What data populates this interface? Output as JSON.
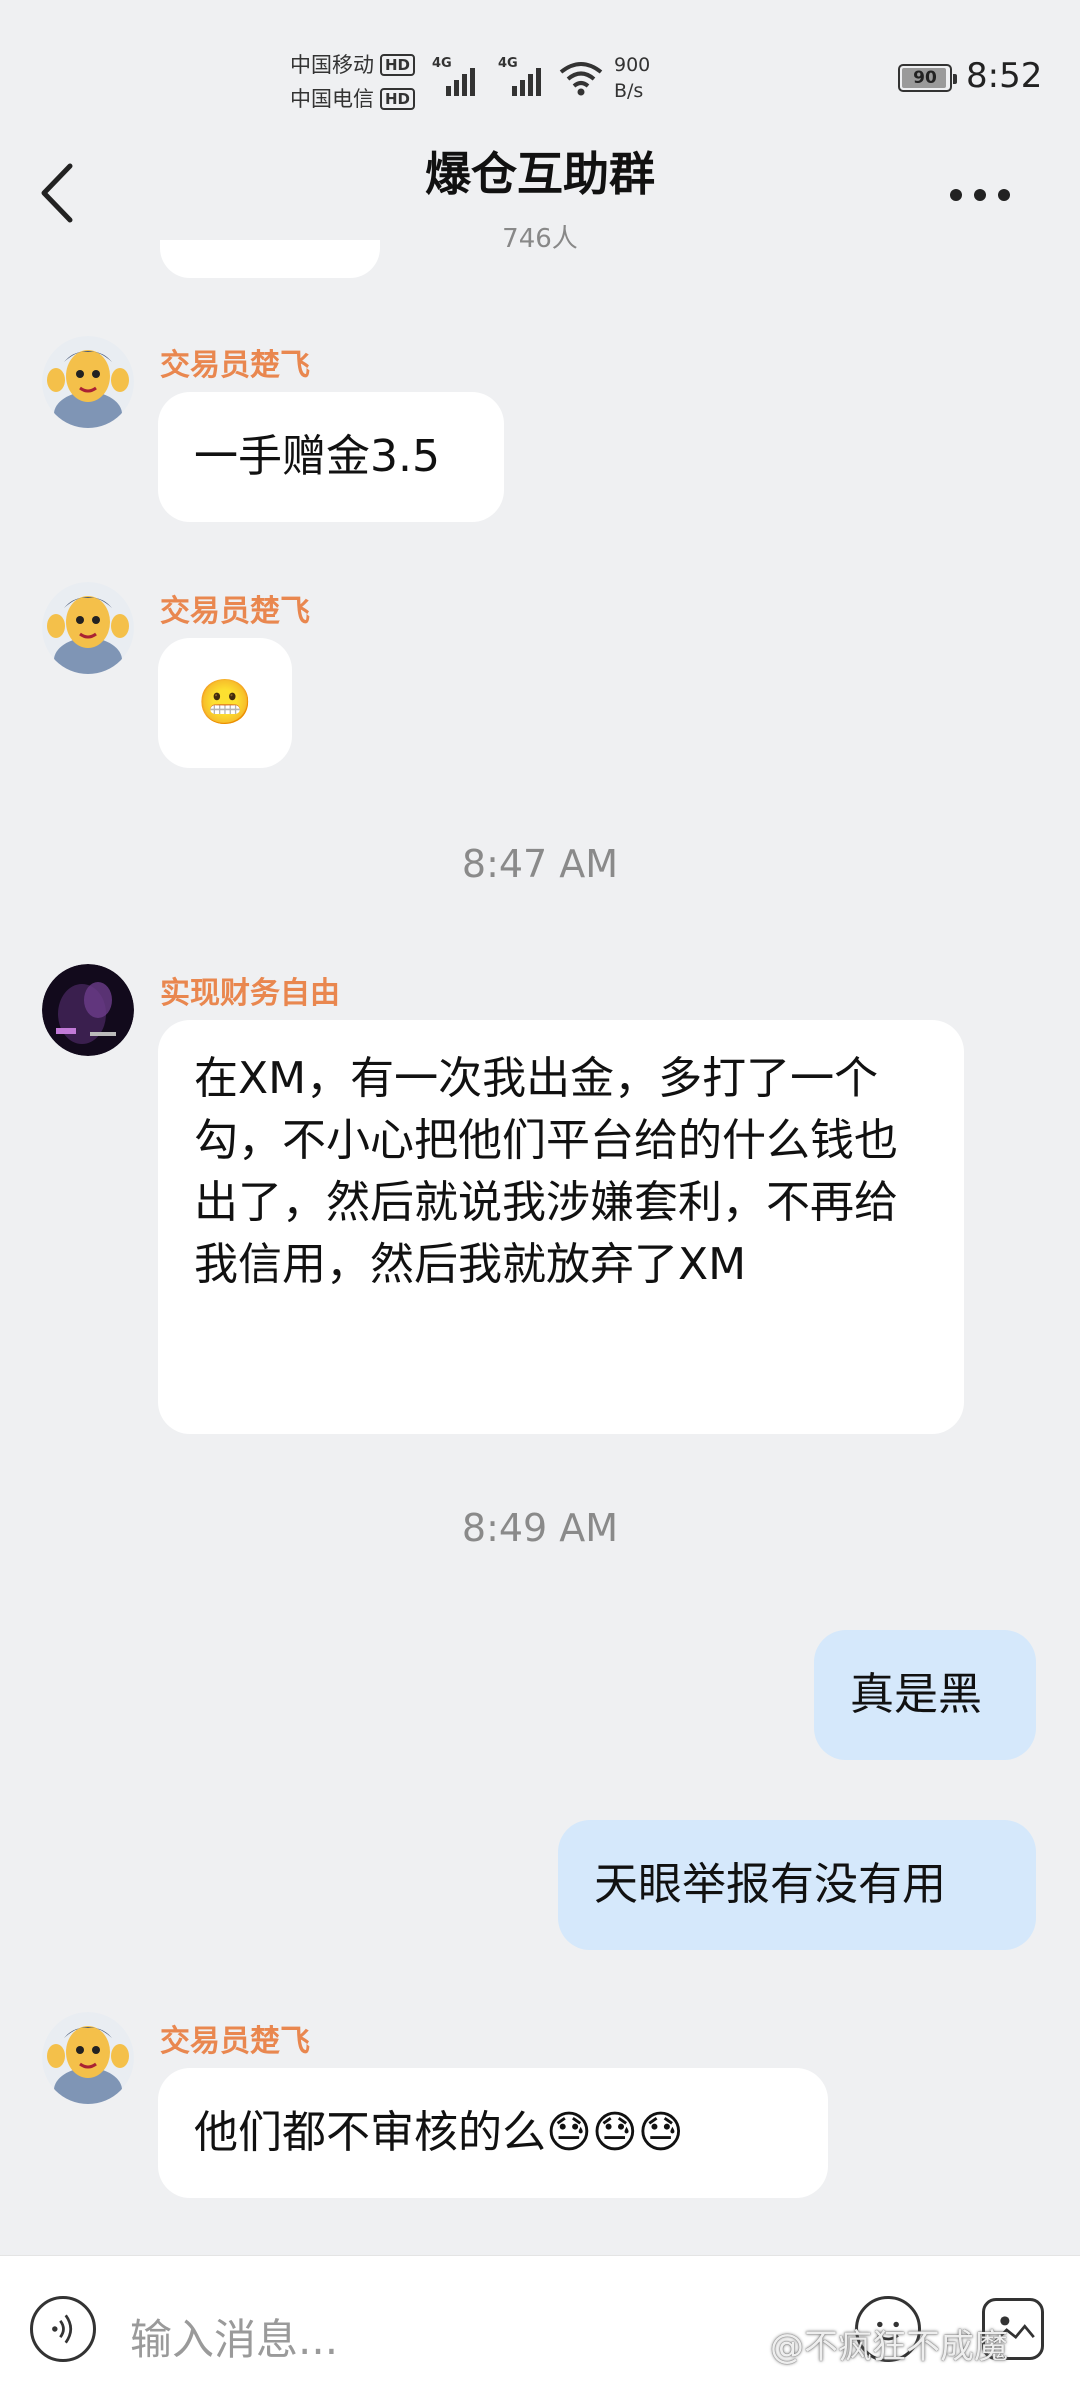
{
  "status_bar": {
    "carrier_1": "中国移动",
    "carrier_2": "中国电信",
    "hd_badge": "HD",
    "network_1": "4G",
    "network_2": "4G",
    "speed_value": "900",
    "speed_unit": "B/s",
    "battery": "90",
    "time": "8:52"
  },
  "header": {
    "title": "爆仓互助群",
    "member_count": "746人"
  },
  "messages": [
    {
      "sender": "交易员楚飞",
      "text": "一手赠金3.5"
    },
    {
      "sender": "交易员楚飞",
      "text": "😬"
    },
    {
      "timestamp": "8:47 AM"
    },
    {
      "sender": "实现财务自由",
      "text": "在XM，有一次我出金，多打了一个勾，不小心把他们平台给的什么钱也出了，然后就说我涉嫌套利，不再给我信用，然后我就放弃了XM"
    },
    {
      "timestamp": "8:49 AM"
    },
    {
      "sender": "me",
      "text": "真是黑"
    },
    {
      "sender": "me",
      "text": "天眼举报有没有用"
    },
    {
      "sender": "交易员楚飞",
      "text": "他们都不审核的么😓😓😓"
    }
  ],
  "input": {
    "placeholder": "输入消息..."
  },
  "watermark": "@不疯狂不成魔",
  "colors": {
    "background": "#eff0f2",
    "sender_name": "#e9874f",
    "my_bubble": "#d5e8fb",
    "other_bubble": "#ffffff"
  }
}
